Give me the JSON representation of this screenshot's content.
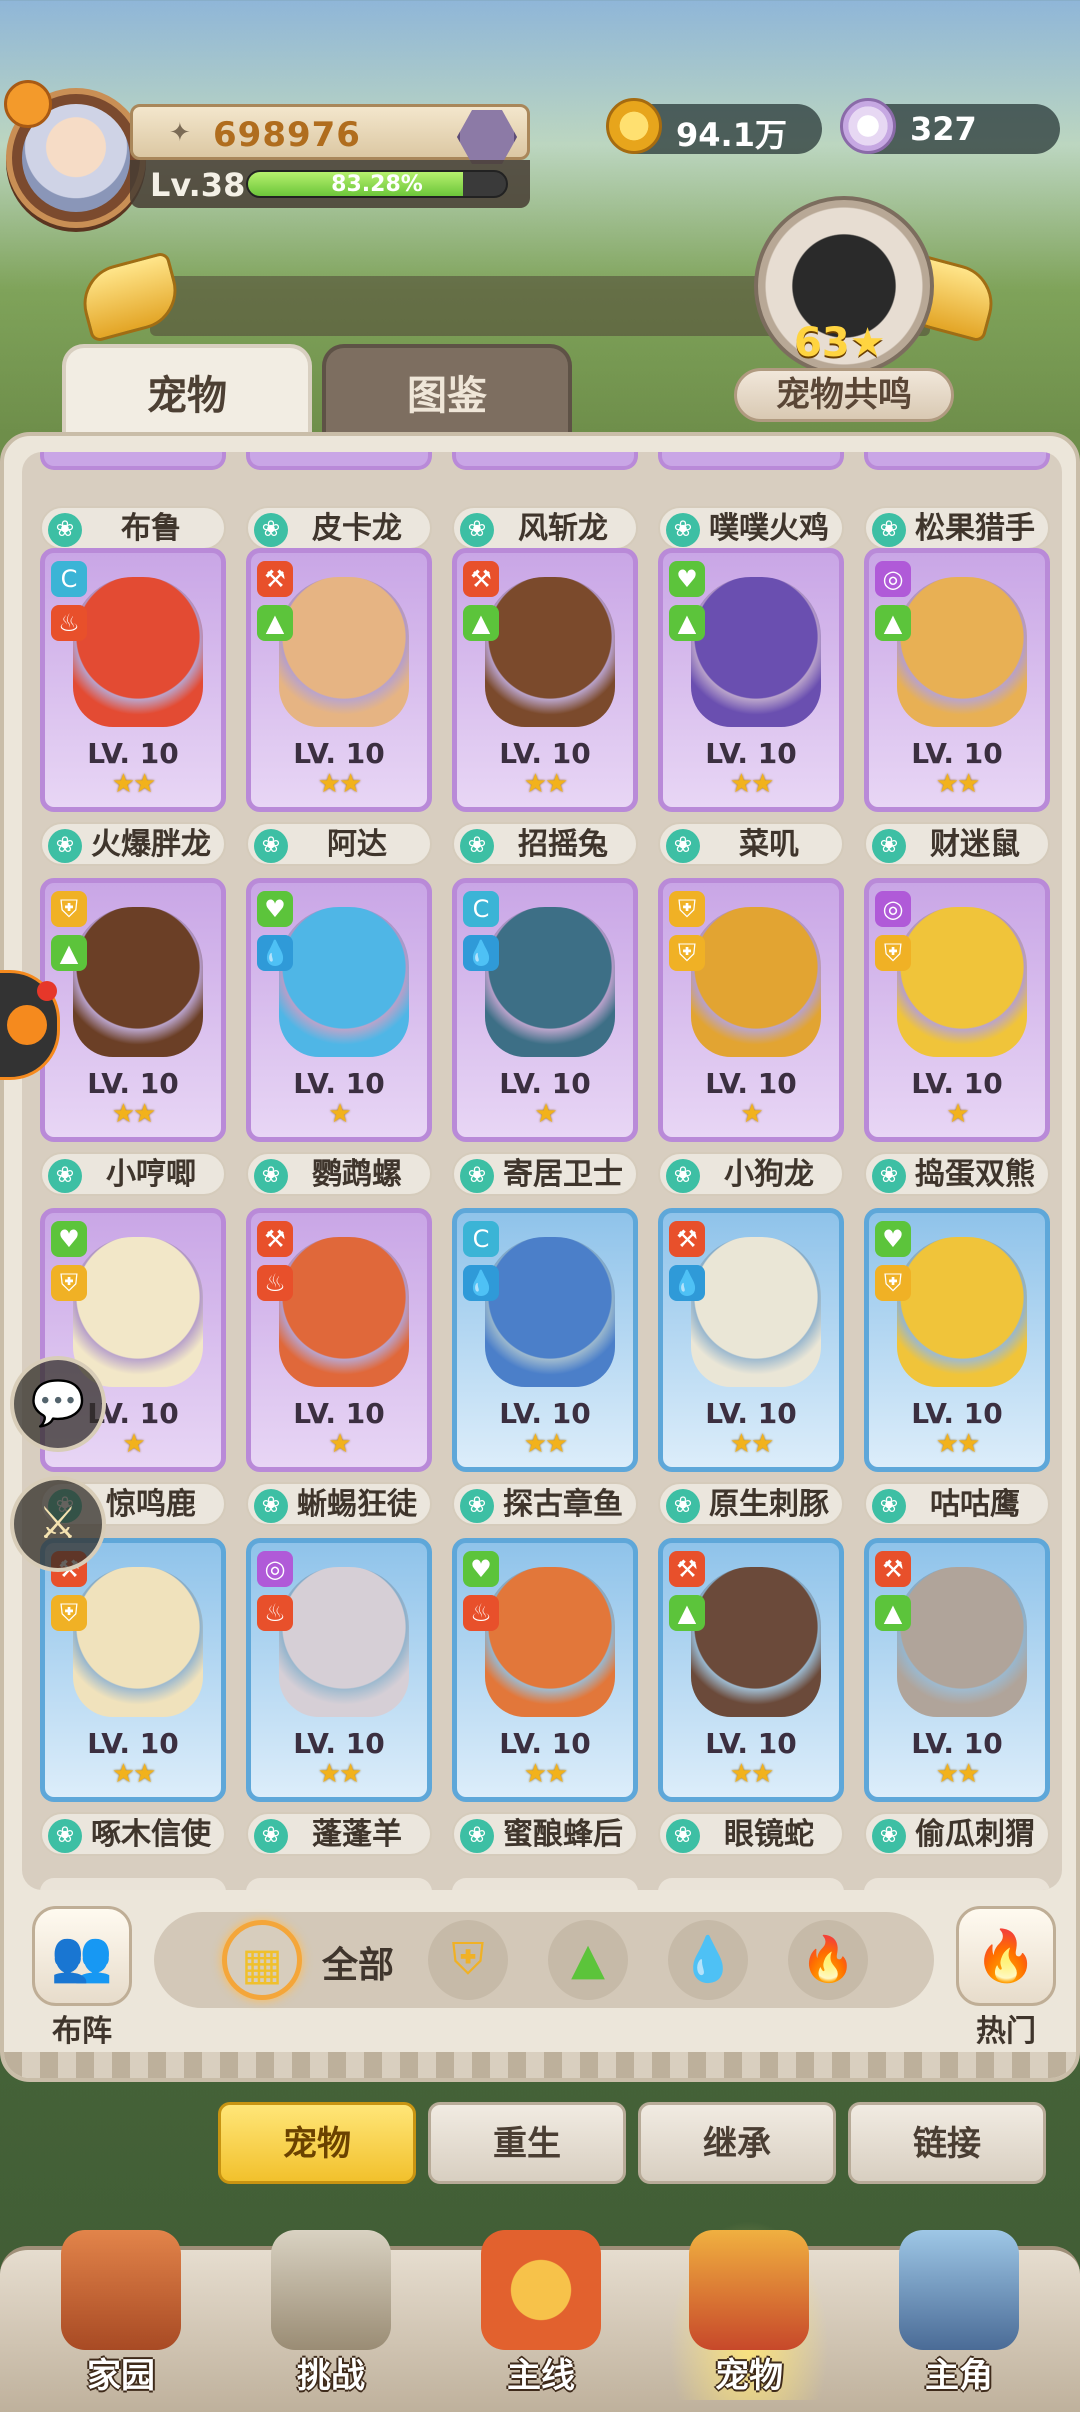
{
  "player": {
    "power": "698976",
    "level": "Lv.38",
    "exp_percent": "83.28%",
    "exp_fraction": 0.8328
  },
  "resources": {
    "gold": "94.1万",
    "shells": "327"
  },
  "resonance": {
    "count": "63",
    "label": "宠物共鸣"
  },
  "tabs": {
    "pets": "宠物",
    "dex": "图鉴"
  },
  "top_row_names": [
    "布鲁",
    "皮卡龙",
    "风斩龙",
    "噗噗火鸡",
    "松果猎手"
  ],
  "pets": [
    {
      "name": "火爆胖龙",
      "level": "LV. 10",
      "stars": "★★",
      "rarity": "purple",
      "color": "#e34b33",
      "b1": "#3bb4d6",
      "b1i": "C",
      "b2": "#e8502b",
      "b2i": "♨"
    },
    {
      "name": "阿达",
      "level": "LV. 10",
      "stars": "★★",
      "rarity": "purple",
      "color": "#e6b483",
      "b1": "#e8502b",
      "b1i": "⚒",
      "b2": "#5cc43b",
      "b2i": "▲"
    },
    {
      "name": "招摇兔",
      "level": "LV. 10",
      "stars": "★★",
      "rarity": "purple",
      "color": "#7b4a2c",
      "b1": "#e8502b",
      "b1i": "⚒",
      "b2": "#5cc43b",
      "b2i": "▲"
    },
    {
      "name": "菜叽",
      "level": "LV. 10",
      "stars": "★★",
      "rarity": "purple",
      "color": "#6a4fb0",
      "b1": "#5cc43b",
      "b1i": "♥",
      "b2": "#5cc43b",
      "b2i": "▲"
    },
    {
      "name": "财迷鼠",
      "level": "LV. 10",
      "stars": "★★",
      "rarity": "purple",
      "color": "#e8b054",
      "b1": "#b05ad8",
      "b1i": "◎",
      "b2": "#5cc43b",
      "b2i": "▲"
    },
    {
      "name": "小哼唧",
      "level": "LV. 10",
      "stars": "★★",
      "rarity": "purple",
      "color": "#6b3f26",
      "b1": "#f0b125",
      "b1i": "⛨",
      "b2": "#5cc43b",
      "b2i": "▲"
    },
    {
      "name": "鹦鹉螺",
      "level": "LV. 10",
      "stars": "★",
      "rarity": "purple",
      "color": "#4fb6e6",
      "b1": "#5cc43b",
      "b1i": "♥",
      "b2": "#2f9ad8",
      "b2i": "💧"
    },
    {
      "name": "寄居卫士",
      "level": "LV. 10",
      "stars": "★",
      "rarity": "purple",
      "color": "#3d6f86",
      "b1": "#3bb4d6",
      "b1i": "C",
      "b2": "#2f9ad8",
      "b2i": "💧"
    },
    {
      "name": "小狗龙",
      "level": "LV. 10",
      "stars": "★",
      "rarity": "purple",
      "color": "#e2a432",
      "b1": "#f0b125",
      "b1i": "⛨",
      "b2": "#f0b125",
      "b2i": "⛨"
    },
    {
      "name": "捣蛋双熊",
      "level": "LV. 10",
      "stars": "★",
      "rarity": "purple",
      "color": "#f0c43a",
      "b1": "#b05ad8",
      "b1i": "◎",
      "b2": "#f0b125",
      "b2i": "⛨"
    },
    {
      "name": "惊鸣鹿",
      "level": "LV. 10",
      "stars": "★",
      "rarity": "purple",
      "color": "#f2e7c8",
      "b1": "#5cc43b",
      "b1i": "♥",
      "b2": "#f0b125",
      "b2i": "⛨"
    },
    {
      "name": "蜥蜴狂徒",
      "level": "LV. 10",
      "stars": "★",
      "rarity": "purple",
      "color": "#e0683a",
      "b1": "#e8502b",
      "b1i": "⚒",
      "b2": "#e8502b",
      "b2i": "♨"
    },
    {
      "name": "探古章鱼",
      "level": "LV. 10",
      "stars": "★★",
      "rarity": "blue",
      "color": "#4b7fc9",
      "b1": "#3bb4d6",
      "b1i": "C",
      "b2": "#2f9ad8",
      "b2i": "💧"
    },
    {
      "name": "原生刺豚",
      "level": "LV. 10",
      "stars": "★★",
      "rarity": "blue",
      "color": "#eae6d6",
      "b1": "#e8502b",
      "b1i": "⚒",
      "b2": "#2f9ad8",
      "b2i": "💧"
    },
    {
      "name": "咕咕鹰",
      "level": "LV. 10",
      "stars": "★★",
      "rarity": "blue",
      "color": "#f0c43a",
      "b1": "#5cc43b",
      "b1i": "♥",
      "b2": "#f0b125",
      "b2i": "⛨"
    },
    {
      "name": "啄木信使",
      "level": "LV. 10",
      "stars": "★★",
      "rarity": "blue",
      "color": "#f0e2bc",
      "b1": "#e8502b",
      "b1i": "⚒",
      "b2": "#f0b125",
      "b2i": "⛨"
    },
    {
      "name": "蓬蓬羊",
      "level": "LV. 10",
      "stars": "★★",
      "rarity": "blue",
      "color": "#d6cfd6",
      "b1": "#b05ad8",
      "b1i": "◎",
      "b2": "#e8502b",
      "b2i": "♨"
    },
    {
      "name": "蜜酿蜂后",
      "level": "LV. 10",
      "stars": "★★",
      "rarity": "blue",
      "color": "#e2773a",
      "b1": "#5cc43b",
      "b1i": "♥",
      "b2": "#e8502b",
      "b2i": "♨"
    },
    {
      "name": "眼镜蛇",
      "level": "LV. 10",
      "stars": "★★",
      "rarity": "blue",
      "color": "#6b4a3a",
      "b1": "#e8502b",
      "b1i": "⚒",
      "b2": "#5cc43b",
      "b2i": "▲"
    },
    {
      "name": "偷瓜刺猬",
      "level": "LV. 10",
      "stars": "★★",
      "rarity": "blue",
      "color": "#b0a49a",
      "b1": "#e8502b",
      "b1i": "⚒",
      "b2": "#5cc43b",
      "b2i": "▲"
    }
  ],
  "filters": {
    "formation": "布阵",
    "all": "全部",
    "hot": "热门"
  },
  "actions": [
    "宠物",
    "重生",
    "继承",
    "链接"
  ],
  "nav": [
    "家园",
    "挑战",
    "主线",
    "宠物",
    "主角"
  ]
}
